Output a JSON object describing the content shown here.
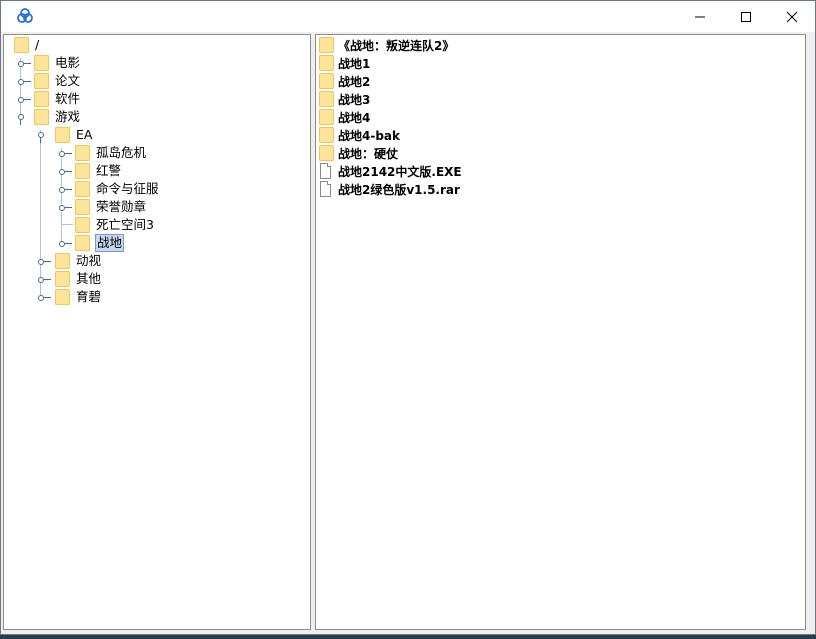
{
  "window": {
    "app_icon": "link-rings-icon",
    "controls": [
      "minimize-icon",
      "maximize-icon",
      "close-icon"
    ]
  },
  "tree": {
    "root": "/",
    "level1": [
      "电影",
      "论文",
      "软件",
      "游戏"
    ],
    "games_child": "EA",
    "ea_children": [
      "孤岛危机",
      "红警",
      "命令与征服",
      "荣誉勋章",
      "死亡空间3",
      "战地"
    ],
    "games_others": [
      "动视",
      "其他",
      "育碧"
    ],
    "selected": "战地"
  },
  "list": {
    "folders": [
      "《战地：叛逆连队2》",
      "战地1",
      "战地2",
      "战地3",
      "战地4",
      "战地4-bak",
      "战地：硬仗"
    ],
    "files": [
      "战地2142中文版.EXE",
      "战地2绿色版v1.5.rar"
    ]
  },
  "colors": {
    "folder": "#fde49a",
    "selection": "#c8d8ee",
    "tree_lines": "#b0c4d8"
  }
}
